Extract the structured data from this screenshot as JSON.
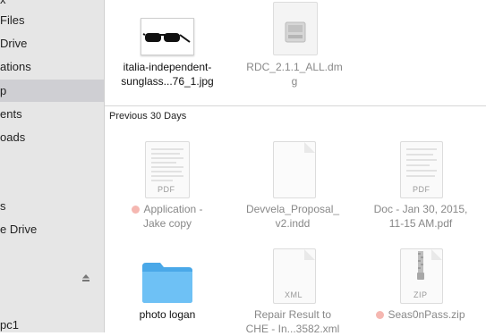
{
  "sidebar": {
    "items": [
      {
        "label": "x"
      },
      {
        "label": "Files"
      },
      {
        "label": "Drive"
      },
      {
        "label": "ations"
      },
      {
        "label": "p"
      },
      {
        "label": "ents"
      },
      {
        "label": "oads"
      },
      {
        "label": "s"
      },
      {
        "label": "e Drive"
      },
      {
        "label": "pc1"
      }
    ]
  },
  "sections": {
    "recent": {
      "files": [
        {
          "name_line1": "italia-independent-",
          "name_line2": "sunglass...76_1.jpg",
          "icon": "image-thumbnail-icon"
        },
        {
          "name_line1": "RDC_2.1.1_ALL.dm",
          "name_line2": "g",
          "icon": "disk-image-icon"
        }
      ]
    },
    "previous_30_days": {
      "header": "Previous 30 Days",
      "files": [
        {
          "name_line1": "Application -",
          "name_line2": "Jake copy",
          "icon": "pdf-icon",
          "badge": "PDF",
          "tag_color": "#f5b7b1"
        },
        {
          "name_line1": "Devvela_Proposal_",
          "name_line2": "v2.indd",
          "icon": "document-icon"
        },
        {
          "name_line1": "Doc - Jan 30, 2015,",
          "name_line2": "11-15 AM.pdf",
          "icon": "pdf-icon",
          "badge": "PDF"
        },
        {
          "name_line1": "photo logan",
          "name_line2": "",
          "icon": "folder-icon"
        },
        {
          "name_line1": "Repair Result to",
          "name_line2": "CHE - In...3582.xml",
          "icon": "xml-icon",
          "badge": "XML"
        },
        {
          "name_line1": "Seas0nPass.zip",
          "name_line2": "",
          "icon": "zip-icon",
          "badge": "ZIP",
          "tag_color": "#f5b7b1"
        }
      ]
    }
  }
}
